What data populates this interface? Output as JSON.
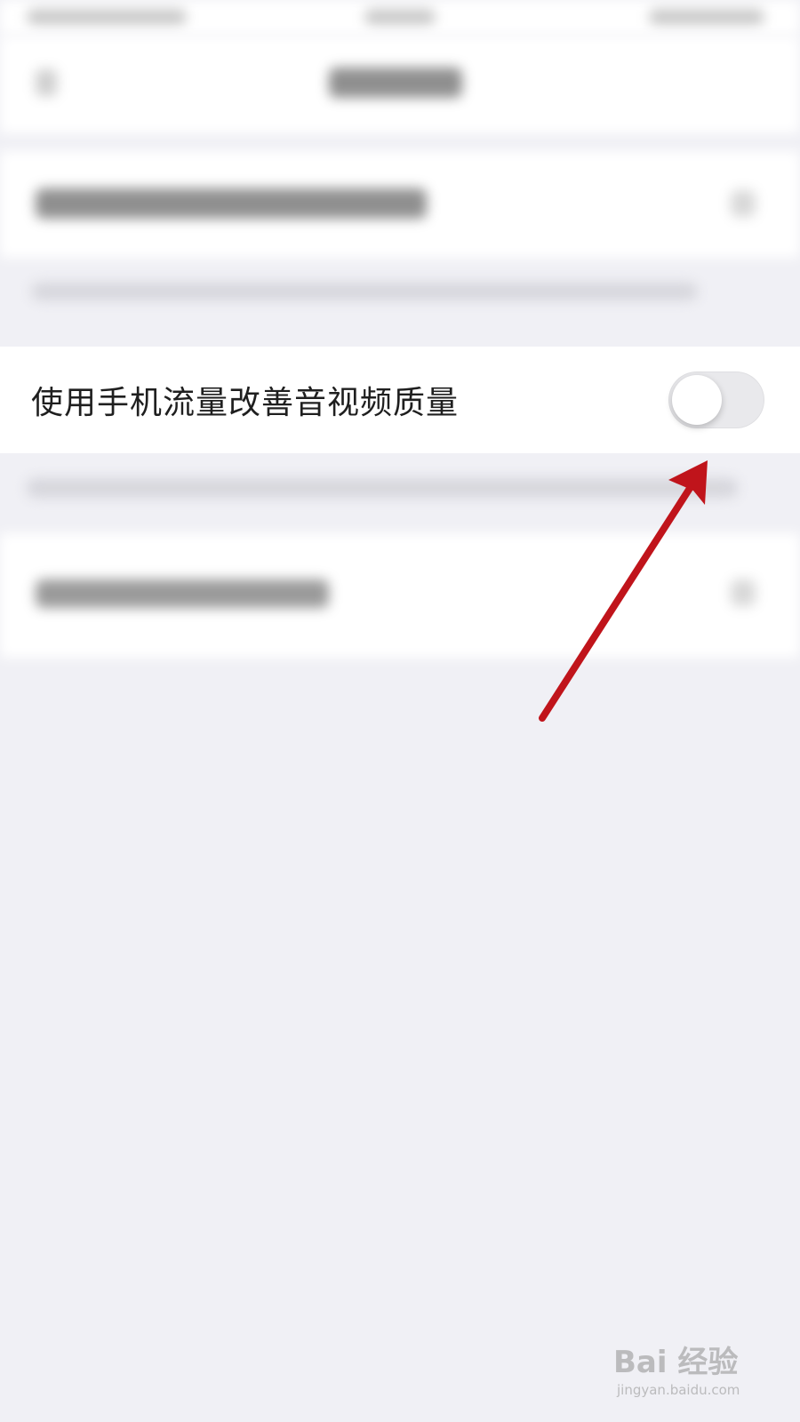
{
  "setting": {
    "label": "使用手机流量改善音视频质量",
    "toggle_on": false
  },
  "colors": {
    "background": "#f0f0f5",
    "row_background": "#ffffff",
    "toggle_off": "#e9e9ec",
    "annotation_arrow": "#c0141b"
  },
  "watermark": {
    "brand": "Bai 经验",
    "url": "jingyan.baidu.com"
  }
}
